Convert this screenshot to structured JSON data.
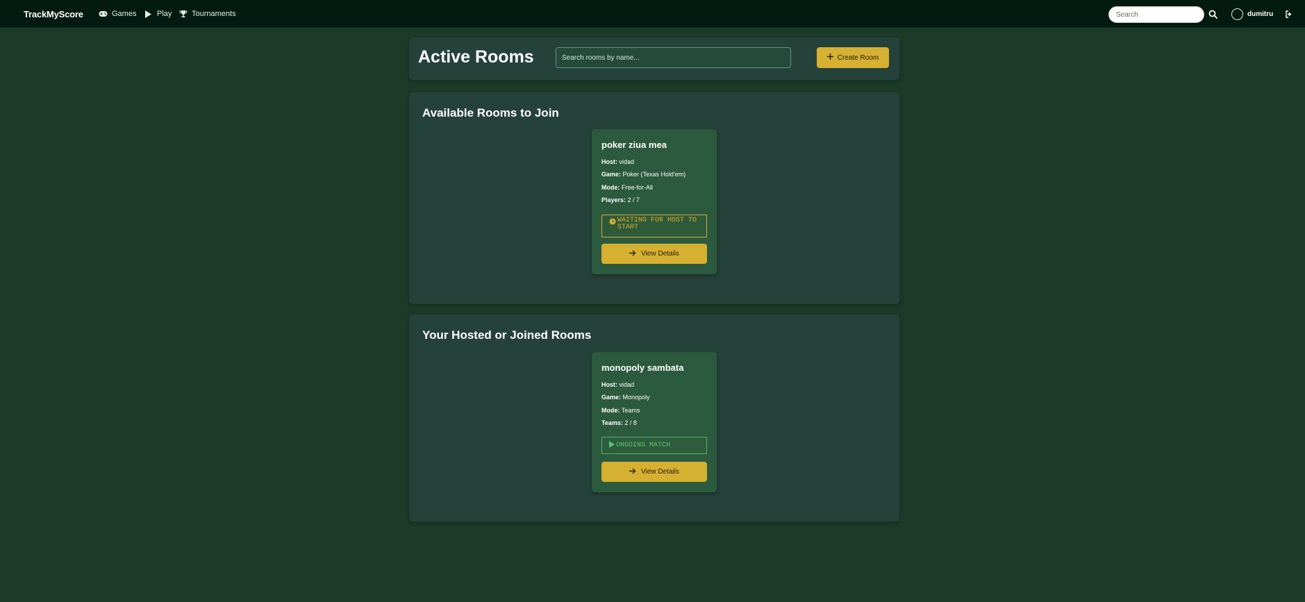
{
  "navbar": {
    "brand": "TrackMyScore",
    "links": [
      {
        "label": "Games",
        "icon": "gamepad-icon"
      },
      {
        "label": "Play",
        "icon": "play-icon"
      },
      {
        "label": "Tournaments",
        "icon": "trophy-icon"
      }
    ],
    "search_placeholder": "Search",
    "username": "dumitru"
  },
  "header": {
    "title": "Active Rooms",
    "search_placeholder": "Search rooms by name...",
    "create_label": "Create Room"
  },
  "sections": {
    "available": {
      "title": "Available Rooms to Join",
      "room": {
        "name": "poker ziua mea",
        "host_key": "Host:",
        "host": "vidad",
        "game_key": "Game:",
        "game": "Poker (Texas Hold'em)",
        "mode_key": "Mode:",
        "mode": "Free-for-All",
        "count_key": "Players:",
        "count": "2 / 7",
        "status": "WAITING FOR HOST TO START",
        "action": "View Details"
      }
    },
    "mine": {
      "title": "Your Hosted or Joined Rooms",
      "room": {
        "name": "monopoly sambata",
        "host_key": "Host:",
        "host": "vidad",
        "game_key": "Game:",
        "game": "Monopoly",
        "mode_key": "Mode:",
        "mode": "Teams",
        "count_key": "Teams:",
        "count": "2 / 8",
        "status": "ONGOING MATCH",
        "action": "View Details"
      }
    }
  },
  "colors": {
    "background": "#1b3a28",
    "navbar": "#021a10",
    "panel": "#25423a",
    "card": "#2c5a3e",
    "accent": "#d6b030",
    "ongoing": "#5ac36f"
  }
}
